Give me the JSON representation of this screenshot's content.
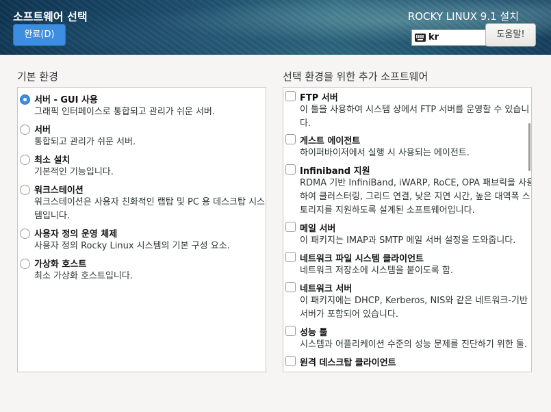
{
  "header": {
    "spoke_title": "소프트웨어 선택",
    "done_label": "완료(D)",
    "product_title": "ROCKY LINUX 9.1 설치",
    "keyboard_layout": "kr",
    "help_label": "도움말!"
  },
  "environments": {
    "heading": "기본 환경",
    "items": [
      {
        "title": "서버 - GUI 사용",
        "desc": [
          "그래픽 인터페이스로 통합되고 관리가 쉬운 서버."
        ],
        "selected": true
      },
      {
        "title": "서버",
        "desc": [
          "통합되고 관리가 쉬운 서버."
        ],
        "selected": false
      },
      {
        "title": "최소 설치",
        "desc": [
          "기본적인 기능입니다."
        ],
        "selected": false
      },
      {
        "title": "워크스테이션",
        "desc": [
          "워크스테이션은 사용자 친화적인 랩탑 및 PC 용 데스크탑 시스",
          "템입니다."
        ],
        "selected": false
      },
      {
        "title": "사용자 정의 운영 체제",
        "desc": [
          "사용자 정의 Rocky Linux 시스템의 기본 구성 요소."
        ],
        "selected": false
      },
      {
        "title": "가상화 호스트",
        "desc": [
          "최소 가상화 호스트입니다."
        ],
        "selected": false
      }
    ]
  },
  "addons": {
    "heading": "선택 환경을 위한 추가 소프트웨어",
    "items": [
      {
        "title": "FTP 서버",
        "desc": [
          "이 툴을 사용하여 시스템 상에서 FTP 서버를 운영할 수 있습니",
          "다."
        ],
        "checked": false
      },
      {
        "title": "게스트 에이전트",
        "desc": [
          "하이퍼바이저에서 실행 시 사용되는 에이전트."
        ],
        "checked": false
      },
      {
        "title": "Infiniband 지원",
        "desc": [
          "RDMA 기반 InfiniBand, iWARP, RoCE, OPA 패브릭을 사용",
          "하여 클러스터링, 그리드 연결, 낮은 지연 시간, 높은 대역폭 스",
          "토리지를 지원하도록 설계된 소프트웨어입니다."
        ],
        "checked": false
      },
      {
        "title": "메일 서버",
        "desc": [
          "이 패키지는 IMAP과 SMTP 메일 서버 설정을 도와줍니다."
        ],
        "checked": false
      },
      {
        "title": "네트워크 파일 시스템 클라이언트",
        "desc": [
          "네트워크 저장소에 시스템을 붙이도록 함."
        ],
        "checked": false
      },
      {
        "title": "네트워크 서버",
        "desc": [
          "이 패키지에는 DHCP, Kerberos, NIS와 같은 네트워크-기반",
          "서버가 포함되어 있습니다."
        ],
        "checked": false
      },
      {
        "title": "성능 툴",
        "desc": [
          "시스템과 어플리케이션 수준의 성능 문제를 진단하기 위한 툴."
        ],
        "checked": false
      },
      {
        "title": "원격 데스크탑 클라이언트",
        "desc": [],
        "checked": false
      }
    ]
  },
  "colors": {
    "accent": "#3d8ee0",
    "header_dark": "#163f5e"
  },
  "icons": {
    "keyboard": "keyboard-icon"
  }
}
